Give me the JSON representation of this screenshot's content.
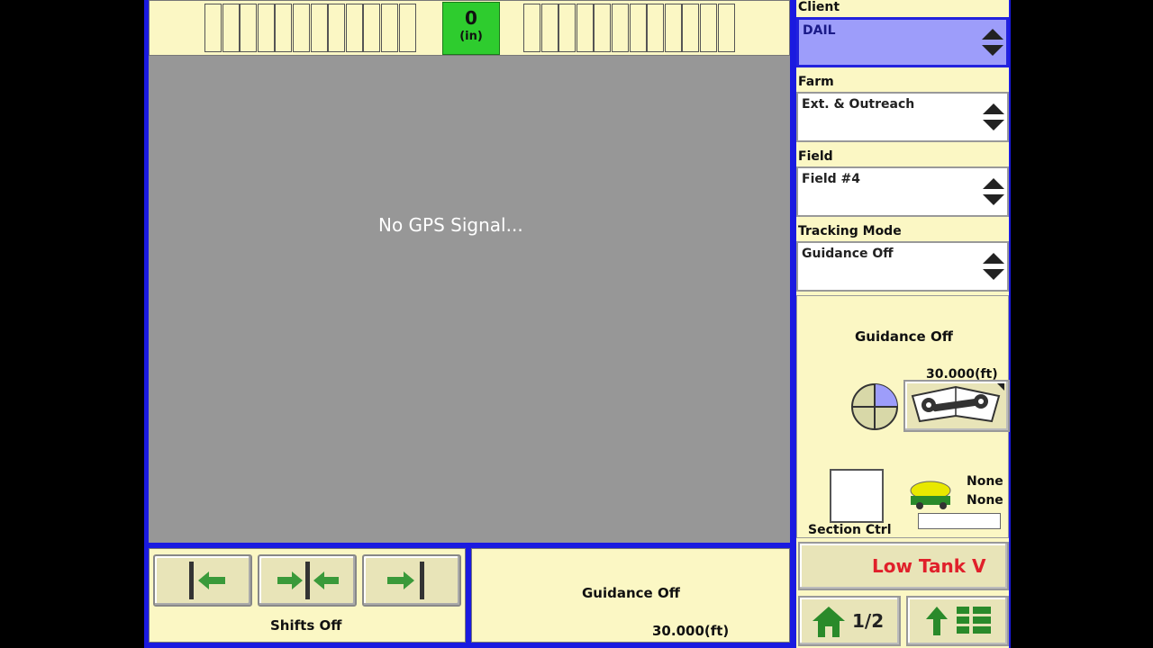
{
  "lightbar": {
    "offset_value": "0",
    "offset_unit": "(in)"
  },
  "map": {
    "status_message": "No GPS Signal..."
  },
  "shifts": {
    "label": "Shifts Off"
  },
  "guidance_panel": {
    "status": "Guidance Off",
    "swath": "30.000(ft)"
  },
  "sidebar": {
    "client_label": "Client",
    "client_value": "DAIL",
    "farm_label": "Farm",
    "farm_value": "Ext. & Outreach",
    "field_label": "Field",
    "field_value": "Field #4",
    "tracking_label": "Tracking Mode",
    "tracking_value": "Guidance Off",
    "guidance_status": "Guidance Off",
    "swath_width": "30.000(ft)",
    "section_ctrl_label": "Section Ctrl",
    "rate_top": "None",
    "rate_bottom": "None",
    "alarm_text": "Low Tank V",
    "page_indicator": "1/2"
  },
  "colors": {
    "background": "#fbf7c4",
    "map": "#979797",
    "center_indicator": "#2ecc2e",
    "client_highlight": "#9d9dfa",
    "alarm_text": "#e0202a",
    "arrow_green": "#3a9a3a"
  }
}
